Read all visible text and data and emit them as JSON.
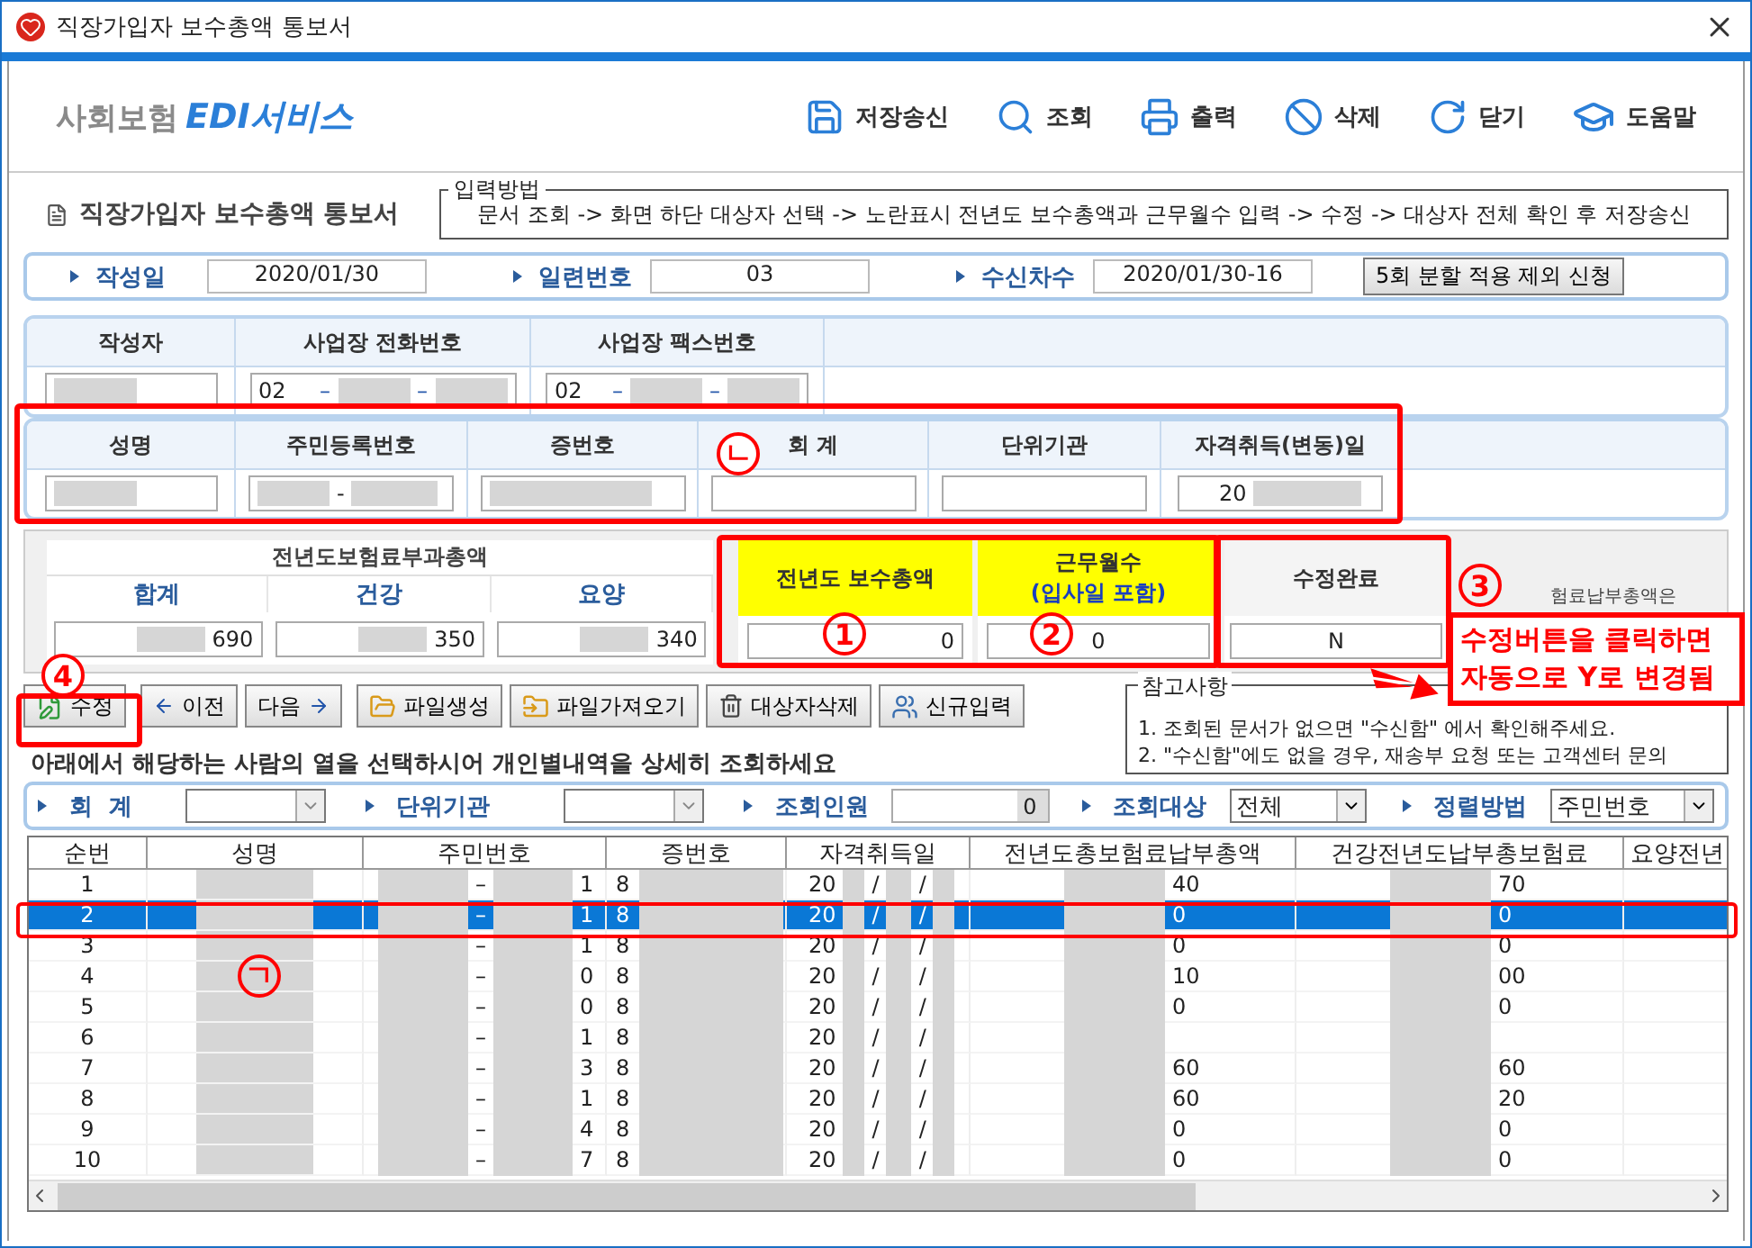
{
  "window": {
    "title": "직장가입자 보수총액 통보서"
  },
  "brand": {
    "prefix": "사회보험",
    "name": "EDI서비스"
  },
  "toolbar": [
    {
      "label": "저장송신",
      "kind": "save"
    },
    {
      "label": "조회",
      "kind": "search"
    },
    {
      "label": "출력",
      "kind": "print"
    },
    {
      "label": "삭제",
      "kind": "delete"
    },
    {
      "label": "닫기",
      "kind": "close"
    },
    {
      "label": "도움말",
      "kind": "help"
    }
  ],
  "document": {
    "title": "직장가입자 보수총액 통보서",
    "method_legend": "입력방법",
    "method": "문서 조회 -> 화면 하단 대상자 선택 -> 노란표시 전년도 보수총액과 근무월수 입력 -> 수정 -> 대상자 전체 확인 후 저장송신"
  },
  "info": {
    "fields": [
      {
        "label": "작성일",
        "value": "2020/01/30"
      },
      {
        "label": "일련번호",
        "value": "03"
      },
      {
        "label": "수신차수",
        "value": "2020/01/30-16"
      }
    ],
    "button": "5회 분할 적용 제외 신청"
  },
  "writer": {
    "columns": [
      "작성자",
      "사업장 전화번호",
      "사업장 팩스번호"
    ],
    "phone": [
      "02",
      "–",
      "–"
    ],
    "fax": [
      "02",
      "–",
      "–"
    ]
  },
  "person": {
    "columns": [
      "성명",
      "주민등록번호",
      "증번호",
      "회 계",
      "단위기관",
      "자격취득(변동)일"
    ],
    "rrn_separator": "-",
    "acquired_prefix": "20"
  },
  "premium": {
    "group": "전년도보험료부과총액",
    "columns": [
      {
        "label": "합계",
        "value": "690"
      },
      {
        "label": "건강",
        "value": "350"
      },
      {
        "label": "요양",
        "value": "340"
      }
    ],
    "salary": {
      "label": "전년도 보수총액",
      "value": "0"
    },
    "months": {
      "label": "근무월수",
      "sub": "(입사일 포함)",
      "value": "0"
    },
    "done": {
      "label": "수정완료",
      "value": "N"
    },
    "note": "험료납부총액은"
  },
  "actions": [
    {
      "label": "수정",
      "kind": "edit"
    },
    {
      "label": "이전",
      "kind": "prev"
    },
    {
      "label": "다음",
      "kind": "next"
    },
    {
      "label": "파일생성",
      "kind": "folder"
    },
    {
      "label": "파일가져오기",
      "kind": "import"
    },
    {
      "label": "대상자삭제",
      "kind": "trash"
    },
    {
      "label": "신규입력",
      "kind": "user"
    }
  ],
  "reference": {
    "title": "참고사항",
    "lines": [
      "1. 조회된 문서가 없으면 \"수신함\" 에서 확인해주세요.",
      "2. \"수신함\"에도 없을 경우, 재송부 요청 또는 고객센터 문의"
    ]
  },
  "hint": "아래에서 해당하는 사람의 열을 선택하시어 개인별내역을 상세히 조회하세요",
  "filters": {
    "account_label": "회  계",
    "unit_label": "단위기관",
    "count_label": "조회인원",
    "count": "0",
    "target_label": "조회대상",
    "target": "전체",
    "sort_label": "정렬방법",
    "sort": "주민번호"
  },
  "table": {
    "columns": [
      "순번",
      "성명",
      "주민번호",
      "증번호",
      "자격취득일",
      "전년도총보험료납부총액",
      "건강전년도납부총보험료",
      "요양전년"
    ],
    "rows": [
      {
        "no": "1",
        "rrn": [
          "–",
          "1"
        ],
        "card": "8",
        "acquired": [
          "20",
          "/",
          "/"
        ],
        "total": "40",
        "health": "70",
        "selected": false
      },
      {
        "no": "2",
        "rrn": [
          "–",
          "1"
        ],
        "card": "8",
        "acquired": [
          "20",
          "/",
          "/"
        ],
        "total": "0",
        "health": "0",
        "selected": true
      },
      {
        "no": "3",
        "rrn": [
          "–",
          "1"
        ],
        "card": "8",
        "acquired": [
          "20",
          "/",
          "/"
        ],
        "total": "0",
        "health": "0",
        "selected": false
      },
      {
        "no": "4",
        "rrn": [
          "–",
          "0"
        ],
        "card": "8",
        "acquired": [
          "20",
          "/",
          "/"
        ],
        "total": "10",
        "health": "00",
        "selected": false
      },
      {
        "no": "5",
        "rrn": [
          "–",
          "0"
        ],
        "card": "8",
        "acquired": [
          "20",
          "/",
          "/"
        ],
        "total": "0",
        "health": "0",
        "selected": false
      },
      {
        "no": "6",
        "rrn": [
          "–",
          "1"
        ],
        "card": "8",
        "acquired": [
          "20",
          "/",
          "/"
        ],
        "total": "",
        "health": "",
        "selected": false
      },
      {
        "no": "7",
        "rrn": [
          "–",
          "3"
        ],
        "card": "8",
        "acquired": [
          "20",
          "/",
          "/"
        ],
        "total": "60",
        "health": "60",
        "selected": false
      },
      {
        "no": "8",
        "rrn": [
          "–",
          "1"
        ],
        "card": "8",
        "acquired": [
          "20",
          "/",
          "/"
        ],
        "total": "60",
        "health": "20",
        "selected": false
      },
      {
        "no": "9",
        "rrn": [
          "–",
          "4"
        ],
        "card": "8",
        "acquired": [
          "20",
          "/",
          "/"
        ],
        "total": "0",
        "health": "0",
        "selected": false
      },
      {
        "no": "10",
        "rrn": [
          "–",
          "7"
        ],
        "card": "8",
        "acquired": [
          "20",
          "/",
          "/"
        ],
        "total": "0",
        "health": "0",
        "selected": false
      }
    ]
  },
  "annotations": {
    "markers": [
      "ㄴ",
      "1",
      "2",
      "3",
      "4",
      "ㄱ"
    ],
    "callout": "수정버튼을 클릭하면\n자동으로 Y로 변경됨"
  }
}
